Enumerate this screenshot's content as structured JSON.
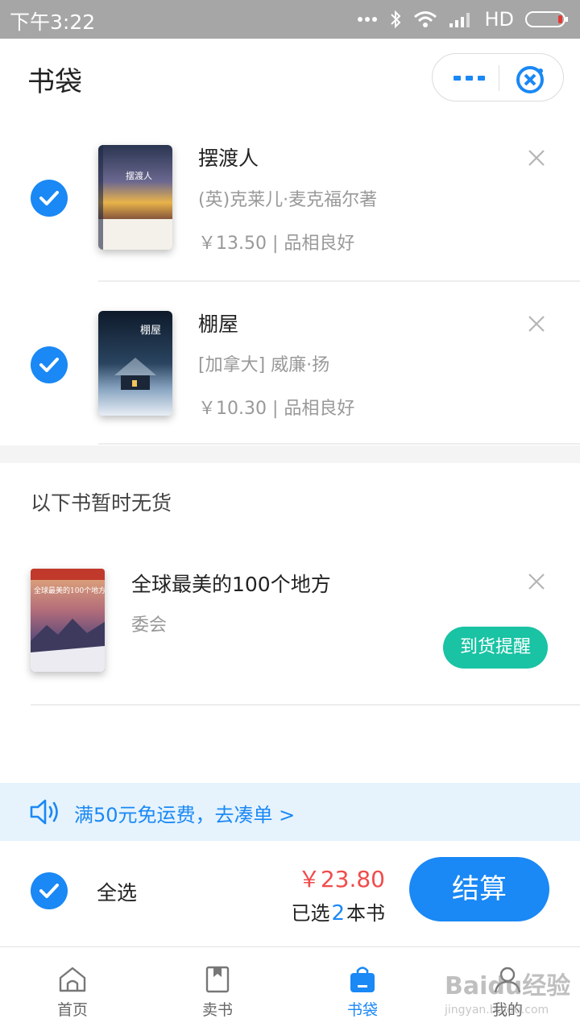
{
  "status_bar": {
    "time": "下午3:22",
    "network": "HD"
  },
  "header": {
    "title": "书袋"
  },
  "cart_items": [
    {
      "title": "摆渡人",
      "author": "(英)克莱儿·麦克福尔著",
      "price_condition": "￥13.50 | 品相良好",
      "checked": true,
      "cover_text": "摆渡人"
    },
    {
      "title": "棚屋",
      "author": "[加拿大] 威廉·扬",
      "price_condition": "￥10.30 | 品相良好",
      "checked": true,
      "cover_text": "棚屋"
    }
  ],
  "out_of_stock": {
    "heading": "以下书暂时无货",
    "items": [
      {
        "title": "全球最美的100个地方",
        "author": "委会",
        "notify_label": "到货提醒",
        "cover_text": "全球最美的100个地方"
      }
    ]
  },
  "promo": {
    "text": "满50元免运费，去凑单 >"
  },
  "checkout": {
    "select_all_label": "全选",
    "total": "￥23.80",
    "selected_prefix": "已选",
    "selected_count": "2",
    "selected_suffix": "本书",
    "pay_label": "结算"
  },
  "tabbar": {
    "tabs": [
      {
        "label": "首页",
        "icon": "home-icon",
        "active": false
      },
      {
        "label": "卖书",
        "icon": "book-icon",
        "active": false
      },
      {
        "label": "书袋",
        "icon": "bag-icon",
        "active": true
      },
      {
        "label": "我的",
        "icon": "user-icon",
        "active": false
      }
    ]
  },
  "watermark": {
    "text": "Baidu经验",
    "subtext": "jingyan.baidu.com"
  },
  "colors": {
    "accent": "#1a88f5",
    "price_red": "#f24b4b",
    "notify_green": "#19c3a4",
    "promo_bg": "#e6f3fd"
  }
}
